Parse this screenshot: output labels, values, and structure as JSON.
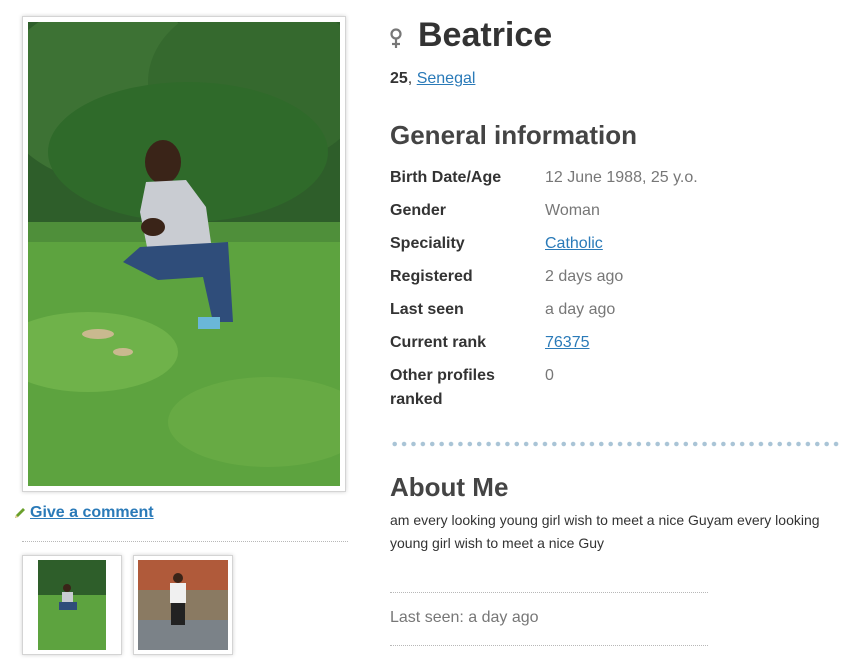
{
  "profile": {
    "name": "Beatrice",
    "gender_icon": "female-symbol-icon",
    "age": "25",
    "separator": ",",
    "location": "Senegal"
  },
  "general": {
    "heading": "General information",
    "rows": [
      {
        "label": "Birth Date/Age",
        "value": "12 June 1988, 25 y.o."
      },
      {
        "label": "Gender",
        "value": "Woman"
      },
      {
        "label": "Speciality",
        "value": "Catholic"
      },
      {
        "label": "Registered",
        "value": "2 days ago"
      },
      {
        "label": "Last seen",
        "value": "a day ago"
      },
      {
        "label": "Current rank",
        "value": "76375"
      },
      {
        "label": "Other profiles ranked",
        "value": "0"
      }
    ]
  },
  "about": {
    "heading": "About Me",
    "text": "am every looking young girl wish to meet a nice Guyam every looking young girl wish to meet a nice Guy"
  },
  "footer": {
    "last_seen": "Last seen: a day ago"
  },
  "comment": {
    "label": "Give a comment",
    "icon": "pencil-icon"
  },
  "colors": {
    "link": "#2a7ab8",
    "heading": "#444444",
    "muted": "#777777",
    "dots": "#a9c4d6"
  }
}
